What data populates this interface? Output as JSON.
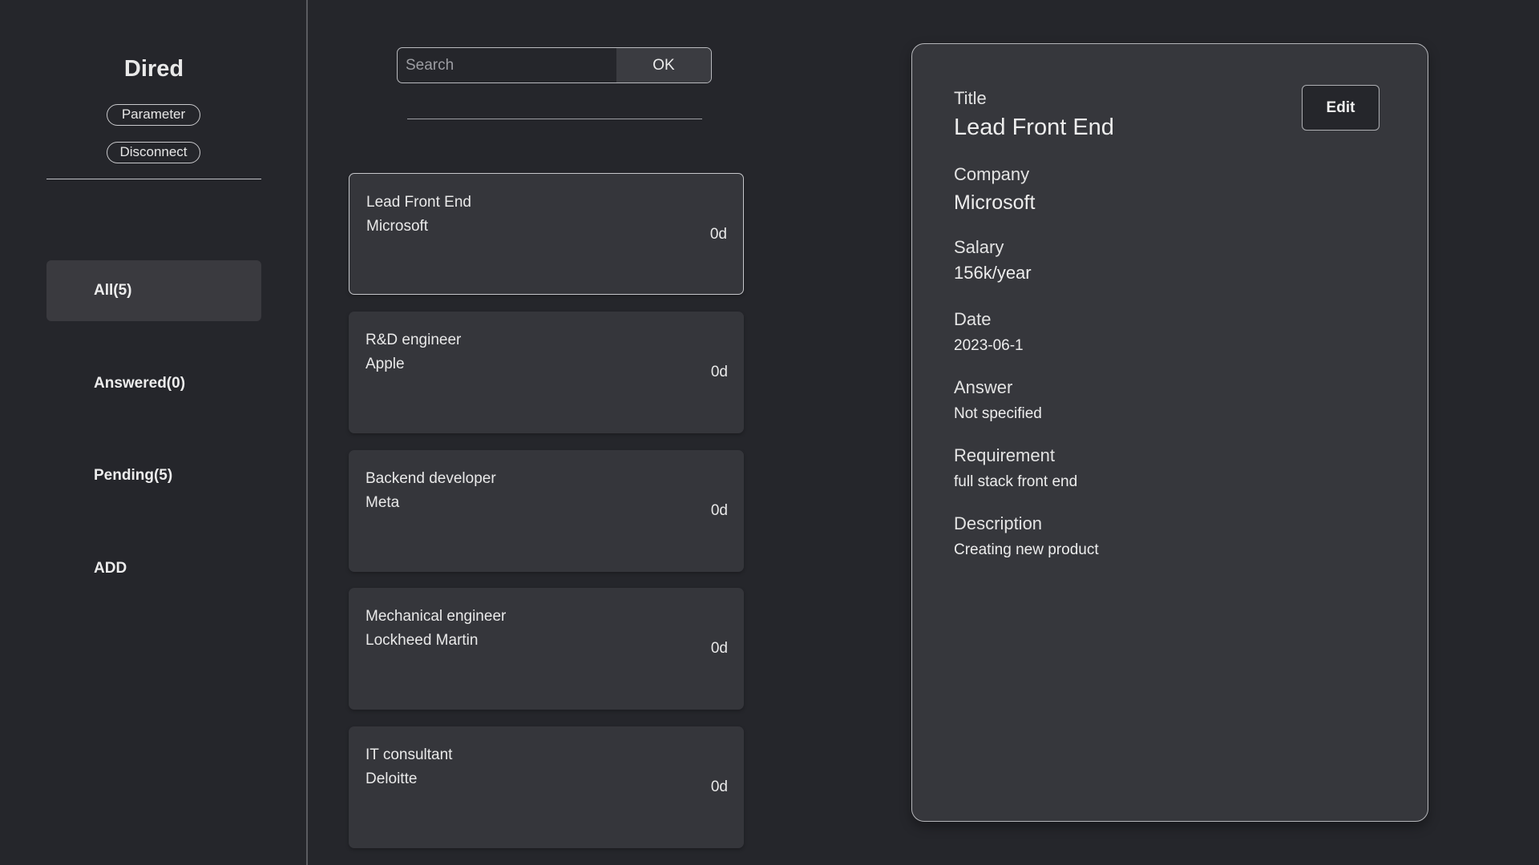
{
  "sidebar": {
    "brand": "Dired",
    "parameter_label": "Parameter",
    "disconnect_label": "Disconnect",
    "nav": [
      {
        "label": "All(5)",
        "active": true
      },
      {
        "label": "Answered(0)"
      },
      {
        "label": "Pending(5)"
      },
      {
        "label": "ADD"
      }
    ]
  },
  "search": {
    "placeholder": "Search",
    "button_label": "OK"
  },
  "jobs": [
    {
      "title": "Lead Front End",
      "company": "Microsoft",
      "age": "0d",
      "selected": true
    },
    {
      "title": "R&D engineer",
      "company": "Apple",
      "age": "0d"
    },
    {
      "title": "Backend developer",
      "company": "Meta",
      "age": "0d"
    },
    {
      "title": "Mechanical engineer",
      "company": "Lockheed Martin",
      "age": "0d"
    },
    {
      "title": "IT consultant",
      "company": "Deloitte",
      "age": "0d"
    }
  ],
  "detail": {
    "edit_label": "Edit",
    "fields": {
      "title": {
        "label": "Title",
        "value": "Lead Front End"
      },
      "company": {
        "label": "Company",
        "value": "Microsoft"
      },
      "salary": {
        "label": "Salary",
        "value": "156k/year"
      },
      "date": {
        "label": "Date",
        "value": "2023-06-1"
      },
      "answer": {
        "label": "Answer",
        "value": "Not specified"
      },
      "requirement": {
        "label": "Requirement",
        "value": "full stack front end"
      },
      "description": {
        "label": "Description",
        "value": "Creating new product"
      }
    }
  },
  "colors": {
    "background": "#25262b",
    "panel": "#36373c",
    "card": "#35363b",
    "active_nav": "#3a3a3f"
  }
}
